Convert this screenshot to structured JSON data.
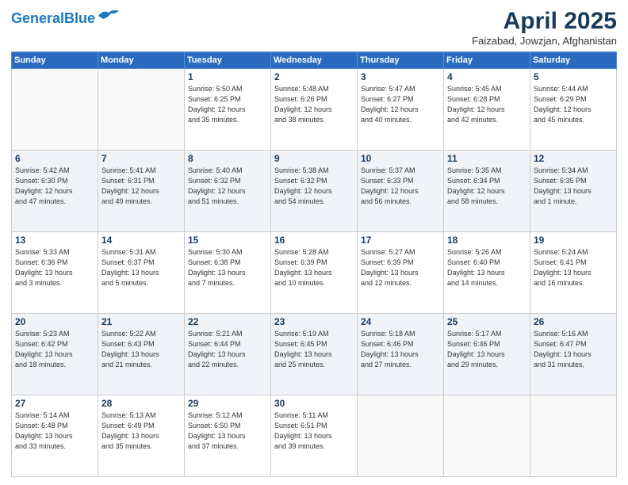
{
  "header": {
    "logo_line1": "General",
    "logo_line2": "Blue",
    "month_year": "April 2025",
    "location": "Faizabad, Jowzjan, Afghanistan"
  },
  "days_of_week": [
    "Sunday",
    "Monday",
    "Tuesday",
    "Wednesday",
    "Thursday",
    "Friday",
    "Saturday"
  ],
  "weeks": [
    [
      {
        "day": "",
        "info": ""
      },
      {
        "day": "",
        "info": ""
      },
      {
        "day": "1",
        "info": "Sunrise: 5:50 AM\nSunset: 6:25 PM\nDaylight: 12 hours\nand 35 minutes."
      },
      {
        "day": "2",
        "info": "Sunrise: 5:48 AM\nSunset: 6:26 PM\nDaylight: 12 hours\nand 38 minutes."
      },
      {
        "day": "3",
        "info": "Sunrise: 5:47 AM\nSunset: 6:27 PM\nDaylight: 12 hours\nand 40 minutes."
      },
      {
        "day": "4",
        "info": "Sunrise: 5:45 AM\nSunset: 6:28 PM\nDaylight: 12 hours\nand 42 minutes."
      },
      {
        "day": "5",
        "info": "Sunrise: 5:44 AM\nSunset: 6:29 PM\nDaylight: 12 hours\nand 45 minutes."
      }
    ],
    [
      {
        "day": "6",
        "info": "Sunrise: 5:42 AM\nSunset: 6:30 PM\nDaylight: 12 hours\nand 47 minutes."
      },
      {
        "day": "7",
        "info": "Sunrise: 5:41 AM\nSunset: 6:31 PM\nDaylight: 12 hours\nand 49 minutes."
      },
      {
        "day": "8",
        "info": "Sunrise: 5:40 AM\nSunset: 6:32 PM\nDaylight: 12 hours\nand 51 minutes."
      },
      {
        "day": "9",
        "info": "Sunrise: 5:38 AM\nSunset: 6:32 PM\nDaylight: 12 hours\nand 54 minutes."
      },
      {
        "day": "10",
        "info": "Sunrise: 5:37 AM\nSunset: 6:33 PM\nDaylight: 12 hours\nand 56 minutes."
      },
      {
        "day": "11",
        "info": "Sunrise: 5:35 AM\nSunset: 6:34 PM\nDaylight: 12 hours\nand 58 minutes."
      },
      {
        "day": "12",
        "info": "Sunrise: 5:34 AM\nSunset: 6:35 PM\nDaylight: 13 hours\nand 1 minute."
      }
    ],
    [
      {
        "day": "13",
        "info": "Sunrise: 5:33 AM\nSunset: 6:36 PM\nDaylight: 13 hours\nand 3 minutes."
      },
      {
        "day": "14",
        "info": "Sunrise: 5:31 AM\nSunset: 6:37 PM\nDaylight: 13 hours\nand 5 minutes."
      },
      {
        "day": "15",
        "info": "Sunrise: 5:30 AM\nSunset: 6:38 PM\nDaylight: 13 hours\nand 7 minutes."
      },
      {
        "day": "16",
        "info": "Sunrise: 5:28 AM\nSunset: 6:39 PM\nDaylight: 13 hours\nand 10 minutes."
      },
      {
        "day": "17",
        "info": "Sunrise: 5:27 AM\nSunset: 6:39 PM\nDaylight: 13 hours\nand 12 minutes."
      },
      {
        "day": "18",
        "info": "Sunrise: 5:26 AM\nSunset: 6:40 PM\nDaylight: 13 hours\nand 14 minutes."
      },
      {
        "day": "19",
        "info": "Sunrise: 5:24 AM\nSunset: 6:41 PM\nDaylight: 13 hours\nand 16 minutes."
      }
    ],
    [
      {
        "day": "20",
        "info": "Sunrise: 5:23 AM\nSunset: 6:42 PM\nDaylight: 13 hours\nand 18 minutes."
      },
      {
        "day": "21",
        "info": "Sunrise: 5:22 AM\nSunset: 6:43 PM\nDaylight: 13 hours\nand 21 minutes."
      },
      {
        "day": "22",
        "info": "Sunrise: 5:21 AM\nSunset: 6:44 PM\nDaylight: 13 hours\nand 22 minutes."
      },
      {
        "day": "23",
        "info": "Sunrise: 5:19 AM\nSunset: 6:45 PM\nDaylight: 13 hours\nand 25 minutes."
      },
      {
        "day": "24",
        "info": "Sunrise: 5:18 AM\nSunset: 6:46 PM\nDaylight: 13 hours\nand 27 minutes."
      },
      {
        "day": "25",
        "info": "Sunrise: 5:17 AM\nSunset: 6:46 PM\nDaylight: 13 hours\nand 29 minutes."
      },
      {
        "day": "26",
        "info": "Sunrise: 5:16 AM\nSunset: 6:47 PM\nDaylight: 13 hours\nand 31 minutes."
      }
    ],
    [
      {
        "day": "27",
        "info": "Sunrise: 5:14 AM\nSunset: 6:48 PM\nDaylight: 13 hours\nand 33 minutes."
      },
      {
        "day": "28",
        "info": "Sunrise: 5:13 AM\nSunset: 6:49 PM\nDaylight: 13 hours\nand 35 minutes."
      },
      {
        "day": "29",
        "info": "Sunrise: 5:12 AM\nSunset: 6:50 PM\nDaylight: 13 hours\nand 37 minutes."
      },
      {
        "day": "30",
        "info": "Sunrise: 5:11 AM\nSunset: 6:51 PM\nDaylight: 13 hours\nand 39 minutes."
      },
      {
        "day": "",
        "info": ""
      },
      {
        "day": "",
        "info": ""
      },
      {
        "day": "",
        "info": ""
      }
    ]
  ]
}
